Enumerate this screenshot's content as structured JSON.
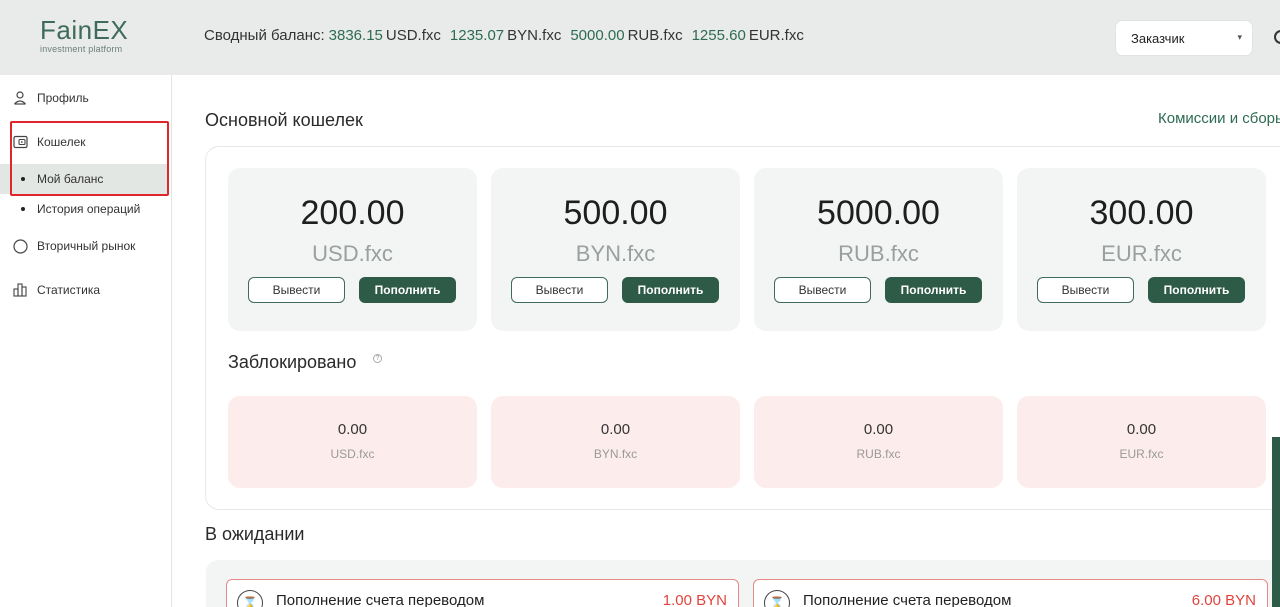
{
  "logo": {
    "main": "FainEX",
    "sub": "investment platform"
  },
  "header": {
    "balance_label": "Сводный баланс:",
    "balances": [
      {
        "amount": "3836.15",
        "currency": "USD.fxc"
      },
      {
        "amount": "1235.07",
        "currency": "BYN.fxc"
      },
      {
        "amount": "5000.00",
        "currency": "RUB.fxc"
      },
      {
        "amount": "1255.60",
        "currency": "EUR.fxc"
      }
    ],
    "role_select": "Заказчик"
  },
  "sidebar": {
    "items": [
      {
        "label": "Профиль",
        "icon": "user-icon"
      },
      {
        "label": "Кошелек",
        "icon": "wallet-icon"
      },
      {
        "label": "Вторичный рынок",
        "icon": "circle-icon"
      },
      {
        "label": "Статистика",
        "icon": "chart-icon"
      }
    ],
    "wallet_sub": [
      {
        "label": "Мой баланс",
        "active": true
      },
      {
        "label": "История операций",
        "active": false
      }
    ]
  },
  "main": {
    "title": "Основной кошелек",
    "fees_link": "Комиссии и сборы",
    "cards": [
      {
        "amount": "200.00",
        "currency": "USD.fxc"
      },
      {
        "amount": "500.00",
        "currency": "BYN.fxc"
      },
      {
        "amount": "5000.00",
        "currency": "RUB.fxc"
      },
      {
        "amount": "300.00",
        "currency": "EUR.fxc"
      }
    ],
    "withdraw_label": "Вывести",
    "deposit_label": "Пополнить",
    "blocked_title": "Заблокировано",
    "help_glyph": "?",
    "blocked": [
      {
        "amount": "0.00",
        "currency": "USD.fxc"
      },
      {
        "amount": "0.00",
        "currency": "BYN.fxc"
      },
      {
        "amount": "0.00",
        "currency": "RUB.fxc"
      },
      {
        "amount": "0.00",
        "currency": "EUR.fxc"
      }
    ],
    "pending_title": "В ожидании",
    "pending": [
      {
        "text": "Пополнение счета переводом",
        "amount": "1.00 BYN"
      },
      {
        "text": "Пополнение счета переводом",
        "amount": "6.00 BYN"
      }
    ]
  },
  "colors": {
    "accent": "#2e5a48",
    "highlight": "#e0262b",
    "blocked_bg": "#fdecec",
    "pending_amount": "#e0453d"
  }
}
